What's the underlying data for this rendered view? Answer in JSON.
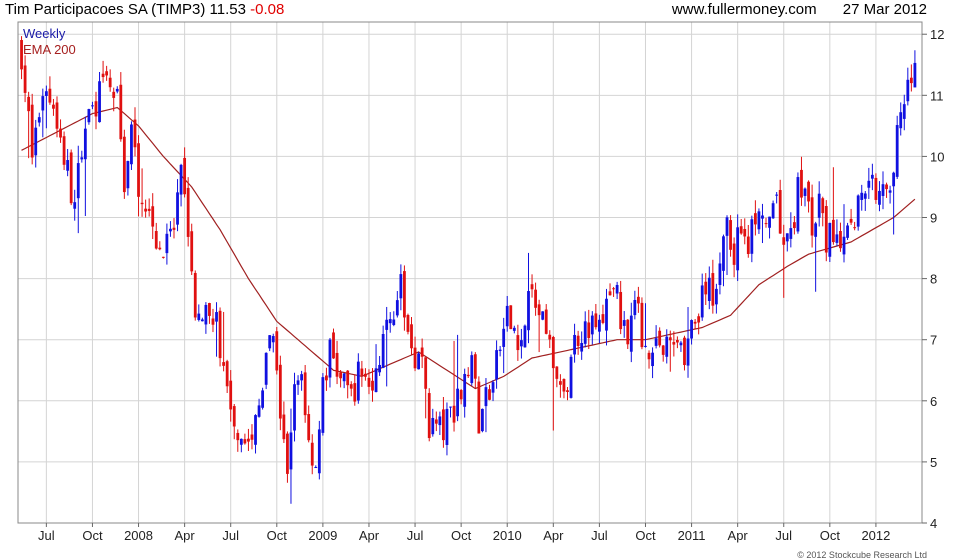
{
  "header": {
    "title": "Tim Participacoes SA (TIMP3)",
    "price": "11.53",
    "change": "-0.08",
    "site": "www.fullermoney.com",
    "date": "27 Mar 2012"
  },
  "legend": {
    "weekly": "Weekly",
    "ema": "EMA 200"
  },
  "copyright": "© 2012 Stockcube Research Ltd",
  "colors": {
    "up": "#1010e0",
    "down": "#e01010",
    "ema": "#a02020",
    "grid": "#d4d4d4",
    "frame": "#888888"
  },
  "chart_data": {
    "type": "candlestick",
    "frequency": "weekly",
    "grid": true,
    "ylim": [
      4,
      12.2
    ],
    "y_ticks": [
      4,
      5,
      6,
      7,
      8,
      9,
      10,
      11,
      12
    ],
    "x_labels": [
      "Jul",
      "Oct",
      "2008",
      "Apr",
      "Jul",
      "Oct",
      "2009",
      "Apr",
      "Jul",
      "Oct",
      "2010",
      "Apr",
      "Jul",
      "Oct",
      "2011",
      "Apr",
      "Jul",
      "Oct",
      "2012"
    ],
    "x_label_weeks": [
      7,
      20,
      33,
      46,
      59,
      72,
      85,
      98,
      111,
      124,
      137,
      150,
      163,
      176,
      189,
      202,
      215,
      228,
      241
    ],
    "close_anchors": [
      [
        0,
        11.7
      ],
      [
        3,
        10.0
      ],
      [
        6,
        11.1
      ],
      [
        9,
        10.9
      ],
      [
        12,
        10.0
      ],
      [
        15,
        9.2
      ],
      [
        18,
        10.6
      ],
      [
        21,
        10.9
      ],
      [
        24,
        11.2
      ],
      [
        27,
        10.9
      ],
      [
        29,
        9.6
      ],
      [
        31,
        10.4
      ],
      [
        33,
        9.6
      ],
      [
        35,
        9.3
      ],
      [
        37,
        9.0
      ],
      [
        39,
        8.4
      ],
      [
        41,
        8.5
      ],
      [
        43,
        8.8
      ],
      [
        45,
        9.6
      ],
      [
        47,
        8.9
      ],
      [
        49,
        7.4
      ],
      [
        51,
        7.1
      ],
      [
        53,
        7.6
      ],
      [
        55,
        7.3
      ],
      [
        57,
        6.4
      ],
      [
        59,
        5.9
      ],
      [
        61,
        5.6
      ],
      [
        63,
        5.4
      ],
      [
        65,
        5.3
      ],
      [
        67,
        5.9
      ],
      [
        69,
        6.6
      ],
      [
        71,
        7.1
      ],
      [
        73,
        5.5
      ],
      [
        75,
        4.9
      ],
      [
        77,
        6.1
      ],
      [
        79,
        6.5
      ],
      [
        81,
        5.3
      ],
      [
        83,
        5.0
      ],
      [
        85,
        6.2
      ],
      [
        87,
        6.8
      ],
      [
        89,
        6.5
      ],
      [
        91,
        6.2
      ],
      [
        93,
        6.1
      ],
      [
        95,
        6.4
      ],
      [
        97,
        6.5
      ],
      [
        99,
        6.1
      ],
      [
        101,
        6.8
      ],
      [
        103,
        7.1
      ],
      [
        105,
        7.6
      ],
      [
        107,
        7.8
      ],
      [
        109,
        7.1
      ],
      [
        111,
        6.8
      ],
      [
        113,
        6.6
      ],
      [
        115,
        5.6
      ],
      [
        117,
        5.6
      ],
      [
        119,
        5.5
      ],
      [
        121,
        5.8
      ],
      [
        123,
        6.0
      ],
      [
        125,
        6.5
      ],
      [
        127,
        6.8
      ],
      [
        129,
        5.5
      ],
      [
        131,
        6.1
      ],
      [
        133,
        6.3
      ],
      [
        135,
        6.9
      ],
      [
        137,
        7.3
      ],
      [
        139,
        7.2
      ],
      [
        141,
        6.9
      ],
      [
        143,
        7.7
      ],
      [
        145,
        7.6
      ],
      [
        147,
        7.2
      ],
      [
        149,
        6.8
      ],
      [
        151,
        6.5
      ],
      [
        153,
        5.9
      ],
      [
        155,
        6.8
      ],
      [
        157,
        7.1
      ],
      [
        159,
        7.3
      ],
      [
        161,
        7.2
      ],
      [
        163,
        7.2
      ],
      [
        165,
        7.5
      ],
      [
        167,
        8.0
      ],
      [
        169,
        7.3
      ],
      [
        171,
        7.2
      ],
      [
        173,
        7.6
      ],
      [
        175,
        7.1
      ],
      [
        177,
        6.9
      ],
      [
        179,
        7.0
      ],
      [
        181,
        6.8
      ],
      [
        183,
        6.9
      ],
      [
        185,
        7.1
      ],
      [
        187,
        6.8
      ],
      [
        189,
        7.2
      ],
      [
        191,
        7.4
      ],
      [
        193,
        7.9
      ],
      [
        195,
        7.6
      ],
      [
        197,
        8.4
      ],
      [
        199,
        8.8
      ],
      [
        201,
        8.4
      ],
      [
        203,
        8.9
      ],
      [
        205,
        8.6
      ],
      [
        207,
        9.0
      ],
      [
        209,
        8.8
      ],
      [
        211,
        8.9
      ],
      [
        213,
        9.1
      ],
      [
        215,
        8.7
      ],
      [
        217,
        8.6
      ],
      [
        219,
        9.5
      ],
      [
        221,
        9.4
      ],
      [
        223,
        8.8
      ],
      [
        225,
        9.2
      ],
      [
        227,
        8.6
      ],
      [
        229,
        8.7
      ],
      [
        231,
        8.4
      ],
      [
        233,
        8.8
      ],
      [
        235,
        9.0
      ],
      [
        237,
        9.5
      ],
      [
        239,
        9.8
      ],
      [
        241,
        9.4
      ],
      [
        243,
        9.7
      ],
      [
        245,
        9.6
      ],
      [
        247,
        10.4
      ],
      [
        249,
        10.7
      ],
      [
        251,
        11.3
      ],
      [
        252,
        11.53
      ]
    ],
    "ema_anchors": [
      [
        0,
        10.1
      ],
      [
        10,
        10.4
      ],
      [
        20,
        10.7
      ],
      [
        27,
        10.8
      ],
      [
        33,
        10.5
      ],
      [
        40,
        10.0
      ],
      [
        48,
        9.5
      ],
      [
        56,
        8.8
      ],
      [
        64,
        8.0
      ],
      [
        72,
        7.3
      ],
      [
        80,
        6.9
      ],
      [
        88,
        6.5
      ],
      [
        96,
        6.4
      ],
      [
        104,
        6.6
      ],
      [
        112,
        6.8
      ],
      [
        120,
        6.5
      ],
      [
        128,
        6.2
      ],
      [
        136,
        6.4
      ],
      [
        144,
        6.7
      ],
      [
        152,
        6.8
      ],
      [
        160,
        6.9
      ],
      [
        168,
        7.0
      ],
      [
        176,
        7.0
      ],
      [
        184,
        7.1
      ],
      [
        192,
        7.2
      ],
      [
        200,
        7.4
      ],
      [
        208,
        7.9
      ],
      [
        216,
        8.2
      ],
      [
        222,
        8.4
      ],
      [
        228,
        8.5
      ],
      [
        234,
        8.6
      ],
      [
        240,
        8.8
      ],
      [
        246,
        9.0
      ],
      [
        252,
        9.3
      ]
    ]
  }
}
